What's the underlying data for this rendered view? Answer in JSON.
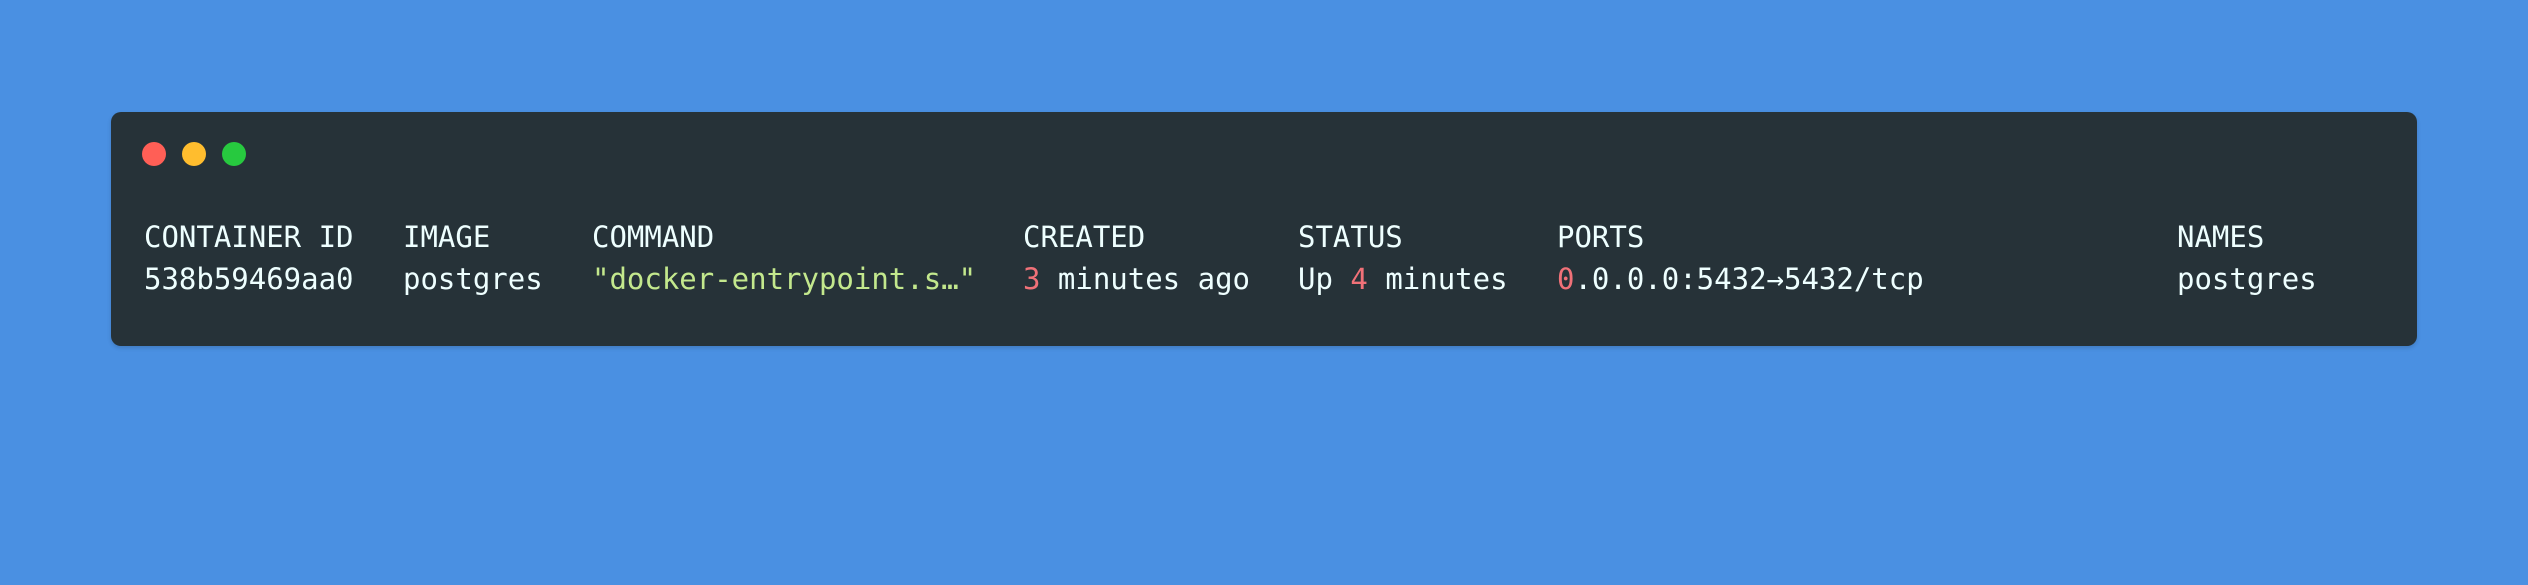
{
  "window_controls": {
    "close_color": "#ff5f56",
    "minimize_color": "#ffbd2e",
    "maximize_color": "#27c93f"
  },
  "colors": {
    "background": "#4a90e2",
    "terminal": "#263238",
    "text": "#eeffff",
    "string": "#c3e88d",
    "number": "#f07178"
  },
  "table": {
    "headers": {
      "container_id": "CONTAINER ID",
      "image": "IMAGE",
      "command": "COMMAND",
      "created": "CREATED",
      "status": "STATUS",
      "ports": "PORTS",
      "names": "NAMES"
    },
    "row": {
      "container_id": "538b59469aa0",
      "image": "postgres",
      "command": "\"docker-entrypoint.s…\"",
      "created_num": "3",
      "created_rest": " minutes ago",
      "status_pre": "Up ",
      "status_num": "4",
      "status_rest": " minutes",
      "ports_num": "0",
      "ports_rest": ".0.0.0:5432→5432/tcp",
      "names": "postgres"
    }
  }
}
